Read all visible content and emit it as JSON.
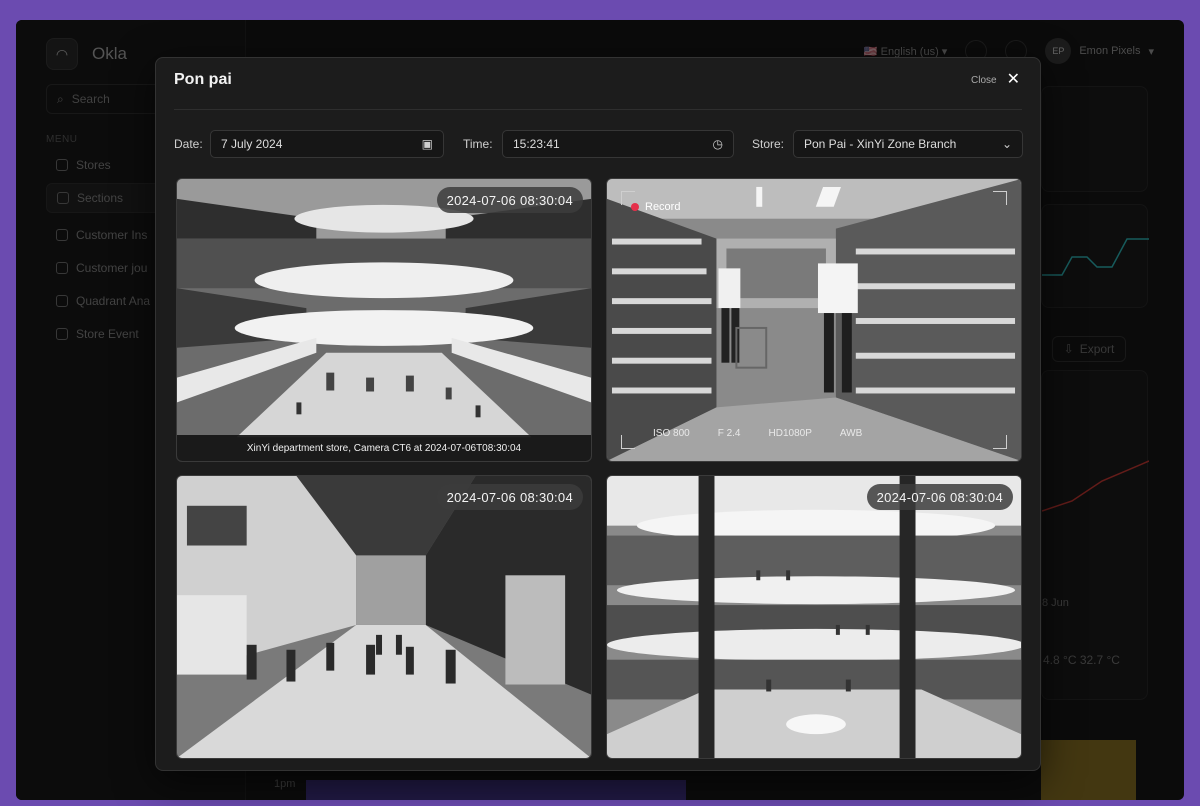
{
  "app": {
    "brand": "Okla",
    "search_placeholder": "Search",
    "menu_label": "MENU",
    "sidebar": [
      {
        "label": "Stores",
        "active": false
      },
      {
        "label": "Sections",
        "active": true
      },
      {
        "label": "Customer Ins",
        "active": false
      },
      {
        "label": "Customer jou",
        "active": false
      },
      {
        "label": "Quadrant Ana",
        "active": false
      },
      {
        "label": "Store Event",
        "active": false
      }
    ],
    "language": "English (us)",
    "user_initials": "EP",
    "user_name": "Emon Pixels",
    "export_label": "Export",
    "bg_texts": {
      "date": "8 Jun",
      "temps": "4.8 °C 32.7 °C",
      "time": "1pm"
    }
  },
  "modal": {
    "title": "Pon pai",
    "close_label": "Close",
    "filters": {
      "date_label": "Date:",
      "date_value": "7 July 2024",
      "time_label": "Time:",
      "time_value": "15:23:41",
      "store_label": "Store:",
      "store_value": "Pon Pai - XinYi Zone Branch"
    },
    "cameras": [
      {
        "timestamp": "2024-07-06  08:30:04",
        "caption": "XinYi department store, Camera CT6 at 2024-07-06T08:30:04"
      },
      {
        "record_label": "Record",
        "hud": [
          "ISO 800",
          "F 2.4",
          "HD1080P",
          "AWB"
        ]
      },
      {
        "timestamp": "2024-07-06  08:30:04"
      },
      {
        "timestamp": "2024-07-06  08:30:04"
      }
    ]
  },
  "colors": {
    "frame": "#6b4bb0",
    "record": "#e5304a",
    "accent": "#2aa7a8"
  }
}
